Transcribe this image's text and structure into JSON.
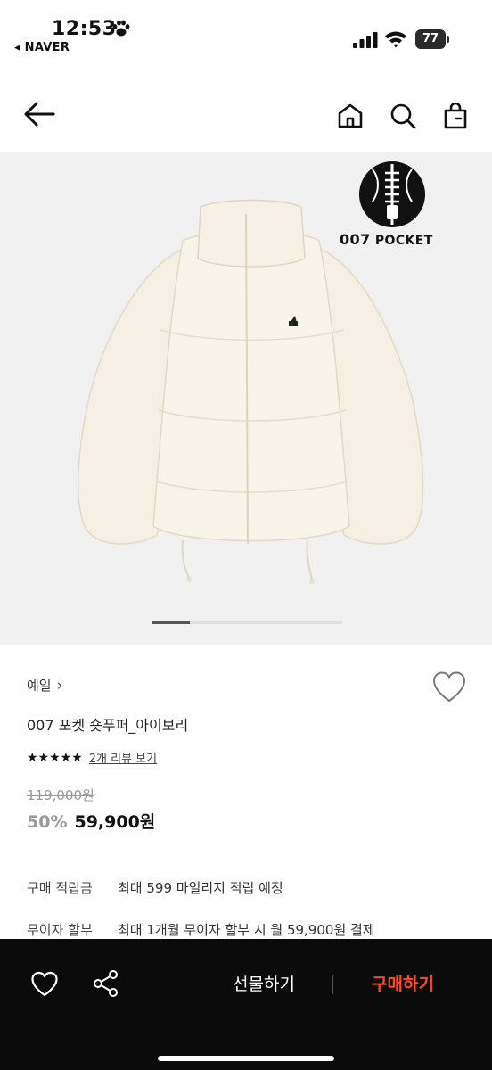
{
  "status_bar": {
    "time": "12:53",
    "back_app": "◂ NAVER",
    "battery": "77"
  },
  "hero": {
    "brand_logo_text": "007",
    "brand_logo_suffix": "POCKET",
    "carousel_active_fraction": 0.2
  },
  "product": {
    "brand": "예일",
    "brand_chevron": "›",
    "title": "007 포켓 숏푸퍼_아이보리",
    "stars": "★★★★★",
    "review_link": "2개 리뷰 보기",
    "original_price": "119,000원",
    "discount": "50%",
    "price": "59,900원"
  },
  "info": [
    {
      "label": "구매 적립금",
      "value": "최대 599 마일리지 적립 예정"
    },
    {
      "label": "무이자 할부",
      "value": "최대 1개월 무이자 할부 시 월 59,900원 결제"
    }
  ],
  "bottom_bar": {
    "gift_label": "선물하기",
    "buy_label": "구매하기",
    "buy_color": "#ff4b1f"
  },
  "icons": [
    "paw-icon",
    "signal-icon",
    "wifi-icon",
    "battery-icon",
    "back-arrow-icon",
    "home-icon",
    "search-icon",
    "shopping-bag-icon",
    "heart-icon",
    "share-icon"
  ]
}
